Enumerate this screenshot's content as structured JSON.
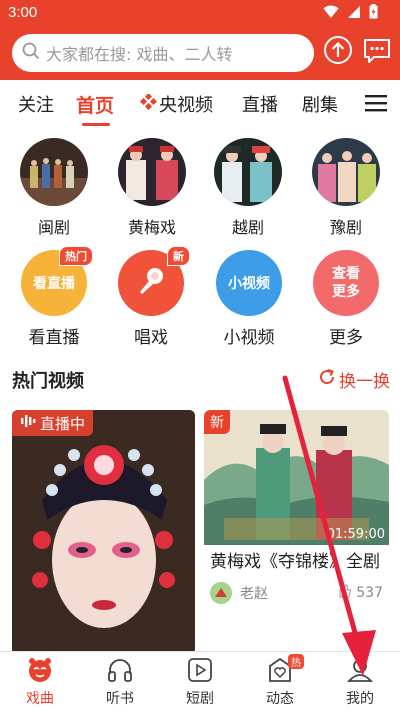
{
  "status": {
    "time": "3:00"
  },
  "search": {
    "placeholder": "大家都在搜: 戏曲、二人转"
  },
  "tabs": [
    {
      "label": "关注"
    },
    {
      "label": "首页"
    },
    {
      "label": "央视频"
    },
    {
      "label": "直播"
    },
    {
      "label": "剧集"
    }
  ],
  "categories": [
    {
      "label": "闽剧"
    },
    {
      "label": "黄梅戏"
    },
    {
      "label": "越剧"
    },
    {
      "label": "豫剧"
    }
  ],
  "services": [
    {
      "circle_text": "看直播",
      "label": "看直播",
      "badge": "热门",
      "color": "#f7b23a"
    },
    {
      "circle_text": "",
      "label": "唱戏",
      "badge": "新",
      "color": "#f0523a"
    },
    {
      "circle_text": "小视频",
      "label": "小视频",
      "badge": "",
      "color": "#3d9de8"
    },
    {
      "circle_text": "查看更多",
      "label": "更多",
      "badge": "",
      "color": "#f26a6a"
    }
  ],
  "section": {
    "title": "热门视频",
    "refresh_label": "换一换"
  },
  "live_card": {
    "tag": "直播中"
  },
  "video_card": {
    "tag": "新",
    "duration": "01:59:00",
    "title": "黄梅戏《夺锦楼》全剧",
    "author": "老赵",
    "likes": "537"
  },
  "bottom_nav": [
    {
      "label": "戏曲",
      "icon": "opera-icon",
      "active": true
    },
    {
      "label": "听书",
      "icon": "headphones-icon",
      "active": false
    },
    {
      "label": "短剧",
      "icon": "play-icon",
      "active": false
    },
    {
      "label": "动态",
      "icon": "heart-icon",
      "active": false,
      "badge": "热"
    },
    {
      "label": "我的",
      "icon": "user-icon",
      "active": false
    }
  ],
  "colors": {
    "accent": "#e8422d",
    "live_tag": "#e8422d",
    "annotation_arrow": "#e5213c"
  }
}
